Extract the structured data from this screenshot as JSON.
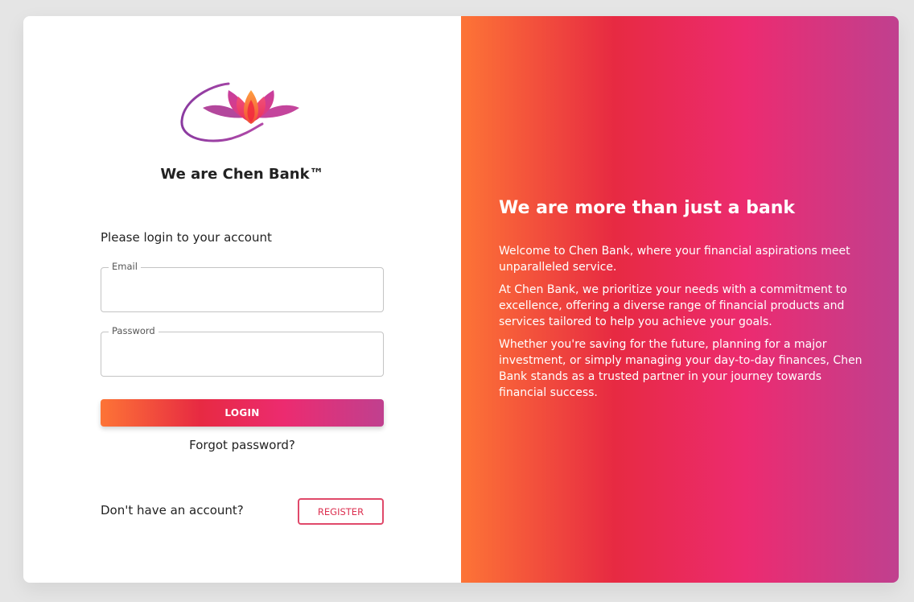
{
  "brand": {
    "logo": "lotus-logo",
    "title": "We are Chen Bank™"
  },
  "login": {
    "prompt": "Please login to your account",
    "email_label": "Email",
    "email_value": "",
    "password_label": "Password",
    "password_value": "",
    "login_button": "LOGIN",
    "forgot_password": "Forgot password?"
  },
  "register": {
    "question": "Don't have an account?",
    "button": "REGISTER"
  },
  "hero": {
    "title": "We are more than just a bank",
    "paragraphs": [
      "Welcome to Chen Bank, where your financial aspirations meet unparalleled service.",
      "At Chen Bank, we prioritize your needs with a commitment to excellence, offering a diverse range of financial products and services tailored to help you achieve your goals.",
      "Whether you're saving for the future, planning for a major investment, or simply managing your day-to-day finances, Chen Bank stands as a trusted partner in your journey towards financial success."
    ]
  },
  "colors": {
    "gradient_start": "#fd7436",
    "gradient_mid1": "#e72a42",
    "gradient_mid2": "#ec2b70",
    "gradient_end": "#c0408f",
    "register_accent": "#e0496a",
    "page_background": "#e5e5e5"
  }
}
